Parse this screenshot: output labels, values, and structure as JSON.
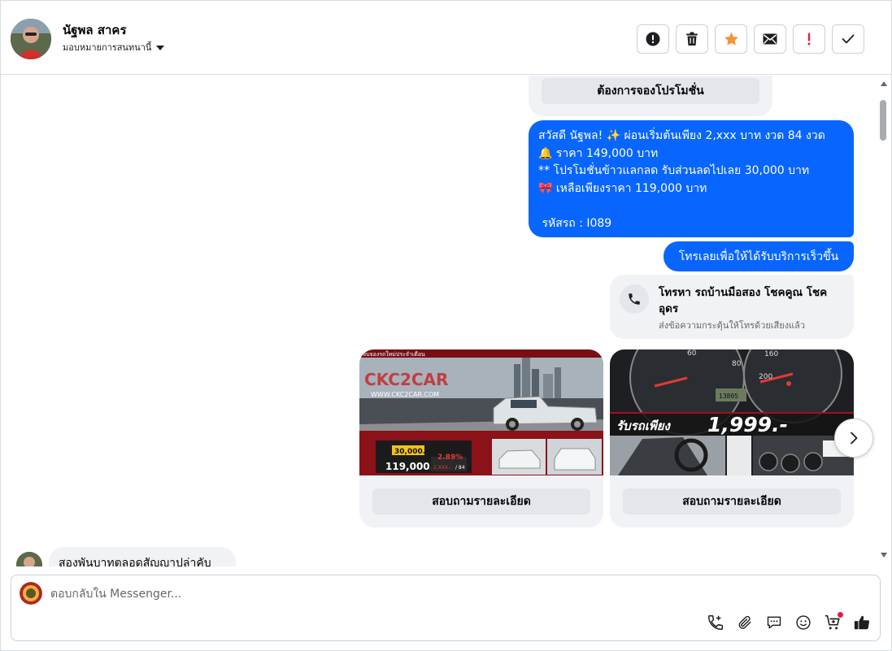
{
  "header": {
    "contact_name": "นัฐพล สาคร",
    "assign_label": "มอบหมายการสนทนานี้",
    "actions": [
      {
        "name": "mark-spam",
        "icon": "exclamation-circle-icon"
      },
      {
        "name": "delete",
        "icon": "trash-icon"
      },
      {
        "name": "follow-up",
        "icon": "star-icon",
        "color": "#f7923b"
      },
      {
        "name": "mark-unread",
        "icon": "envelope-icon"
      },
      {
        "name": "priority",
        "icon": "exclamation-icon",
        "color": "#e41e3f"
      },
      {
        "name": "mark-done",
        "icon": "checkmark-icon"
      }
    ]
  },
  "conversation": {
    "card_top_button": "ต้องการจองโปรโมชั่น",
    "promo_message": {
      "lines": [
        "สวัสดี นัฐพล! ✨  ผ่อนเริ่มต้นเพียง 2,xxx บาท งวด 84 งวด",
        "🔔 ราคา 149,000 บาท",
        "** โปรโมชั่นข้าวแลกลด รับส่วนลดไปเลย 30,000 บาท",
        "🎀  เหลือเพียงราคา 119,000 บาท",
        "",
        " รหัสรถ : I089"
      ]
    },
    "call_prompt": "โทรเลยเพื่อให้ได้รับบริการเร็วขึ้น",
    "call_card": {
      "title": "โทรหา รถบ้านมือสอง โชคคูณ โชคอุดร",
      "subtitle": "ส่งข้อความกระตุ้นให้โทรด้วยเสียงแล้ว"
    },
    "carousel": [
      {
        "button": "สอบถามรายละเอียด",
        "image_text": {
          "banner": "จับจองรถใหม่ประจำเดือน",
          "brand": "CKC2CAR",
          "site": "WWW.CKC2CAR.COM",
          "price_old": "30,000.-",
          "price": "119,000.-",
          "rate": "2.89%",
          "install": "2,XXX.-",
          "months": "/ 84"
        }
      },
      {
        "button": "สอบถามรายละเอียด",
        "image_text": {
          "headline": "รับรถเพียง",
          "price": "1,999.-",
          "odometer": "13805"
        }
      }
    ],
    "incoming_message": "สองพันบาทตลอดสัญญาปล่าคับ"
  },
  "composer": {
    "placeholder": "ตอบกลับใน Messenger...",
    "tools": [
      "phone-plus-icon",
      "paperclip-icon",
      "chat-bubble-icon",
      "smiley-icon",
      "shopping-cart-icon",
      "thumbs-up-icon"
    ]
  }
}
